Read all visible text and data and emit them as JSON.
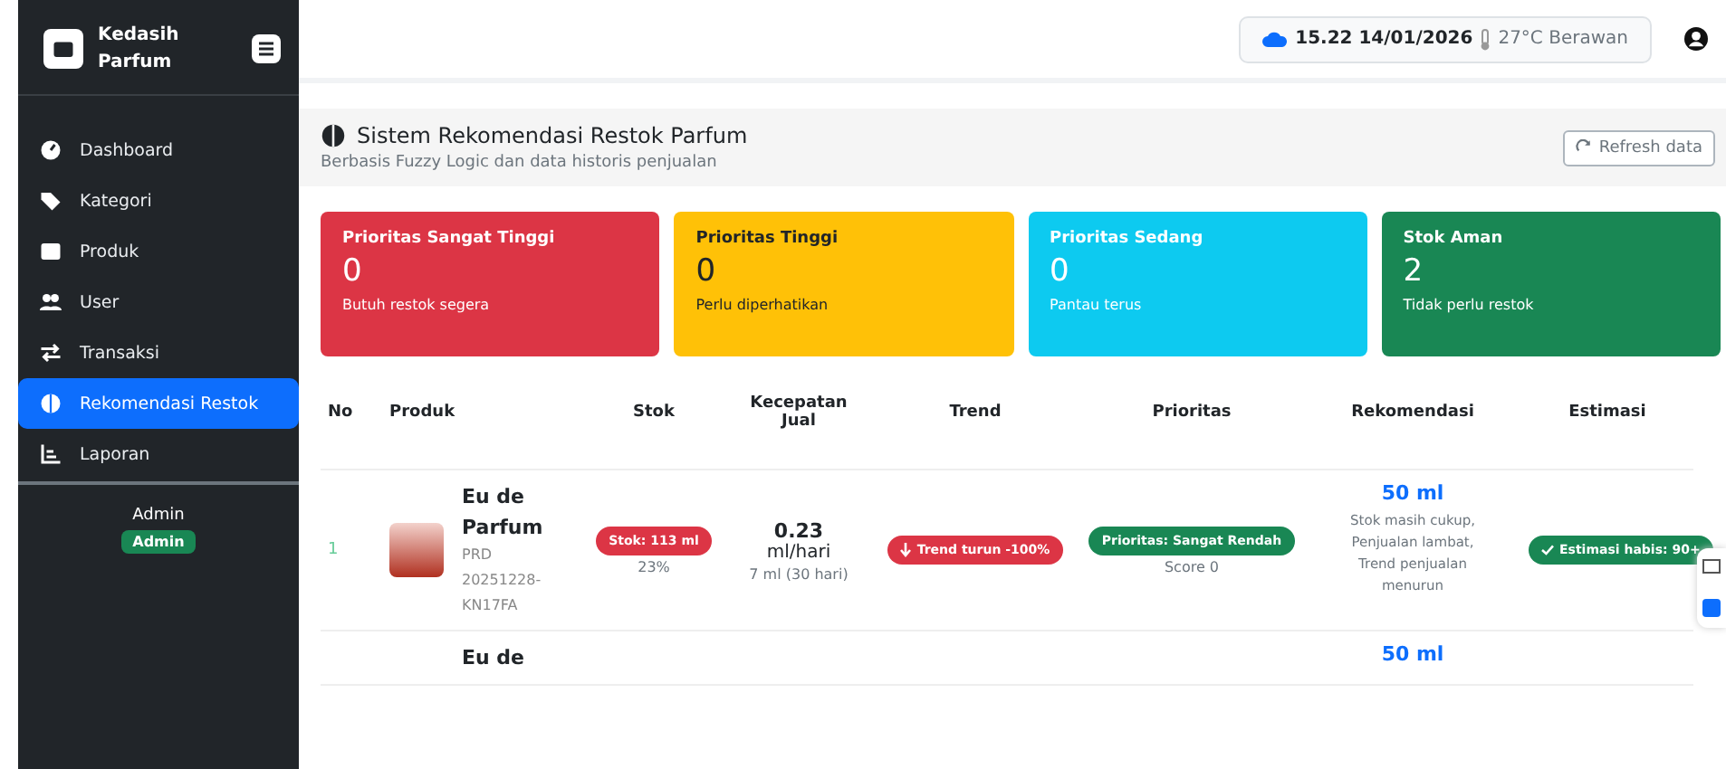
{
  "sidebar": {
    "brand": "Kedasih Parfum",
    "items": [
      {
        "label": "Dashboard",
        "selected": false
      },
      {
        "label": "Kategori",
        "selected": false
      },
      {
        "label": "Produk",
        "selected": false
      },
      {
        "label": "User",
        "selected": false
      },
      {
        "label": "Transaksi",
        "selected": false
      },
      {
        "label": "Rekomendasi Restok",
        "selected": true
      },
      {
        "label": "Laporan",
        "selected": false
      }
    ],
    "user": {
      "name": "Admin",
      "role": "Admin"
    }
  },
  "topbar": {
    "time": "15.22 14/01/2026",
    "weather": "27°C Berawan"
  },
  "header": {
    "title": "Sistem Rekomendasi Restok Parfum",
    "subtitle": "Berbasis Fuzzy Logic dan data historis penjualan",
    "refresh": "Refresh data"
  },
  "cards": [
    {
      "kind": "danger",
      "title": "Prioritas Sangat Tinggi",
      "value": "0",
      "note": "Butuh restok segera"
    },
    {
      "kind": "warning",
      "title": "Prioritas Tinggi",
      "value": "0",
      "note": "Perlu diperhatikan"
    },
    {
      "kind": "info",
      "title": "Prioritas Sedang",
      "value": "0",
      "note": "Pantau terus"
    },
    {
      "kind": "success",
      "title": "Stok Aman",
      "value": "2",
      "note": "Tidak perlu restok"
    }
  ],
  "table": {
    "columns": [
      "No",
      "Produk",
      "Stok",
      "Kecepatan Jual",
      "Trend",
      "Prioritas",
      "Rekomendasi",
      "Estimasi"
    ],
    "rows": [
      {
        "no": "1",
        "name": "Eu de Parfum",
        "code": "PRD 20251228-KN17FA",
        "stock": "Stok: 113 ml",
        "stock_pct": "23%",
        "speed": "0.23",
        "speed_unit": "ml/hari",
        "speed_note": "7 ml (30 hari)",
        "trend": "Trend turun -100%",
        "priority": "Prioritas: Sangat Rendah",
        "score": "Score 0",
        "rec": "50 ml",
        "rec_note": "Stok masih cukup, Penjualan lambat, Trend penjualan menurun",
        "estimate": "Estimasi habis: 90+"
      },
      {
        "name": "Eu de",
        "rec": "50 ml"
      }
    ]
  }
}
